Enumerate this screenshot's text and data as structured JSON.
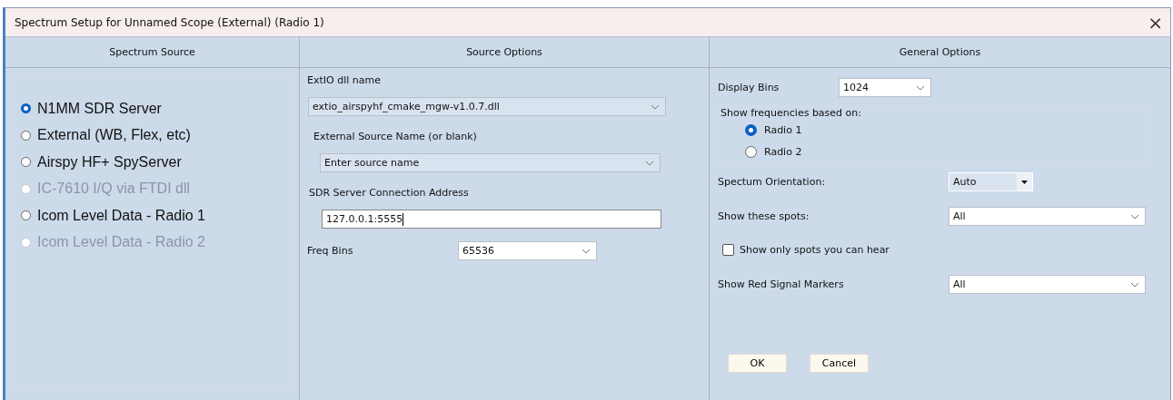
{
  "window": {
    "title": "Spectrum Setup for Unnamed Scope (External) (Radio 1)",
    "close": "×"
  },
  "columns": [
    {
      "title": "Spectrum Source"
    },
    {
      "title": "Source Options"
    },
    {
      "title": "General Options"
    }
  ],
  "spectrum_source": [
    {
      "label": "N1MM SDR Server",
      "selected": true,
      "disabled": false
    },
    {
      "label": "External (WB, Flex, etc)",
      "selected": false,
      "disabled": false
    },
    {
      "label": "Airspy HF+ SpyServer",
      "selected": false,
      "disabled": false
    },
    {
      "label": "IC-7610 I/Q via FTDI dll",
      "selected": false,
      "disabled": true
    },
    {
      "label": "Icom Level Data - Radio 1",
      "selected": false,
      "disabled": false
    },
    {
      "label": "Icom Level Data - Radio 2",
      "selected": false,
      "disabled": true
    }
  ],
  "source_options": [
    {
      "kind": "combo",
      "label": "ExtIO dll name",
      "value": "extio_airspyhf_cmake_mgw-v1.0.7.dll"
    },
    {
      "kind": "combo",
      "label": "External Source Name (or blank)",
      "value": "Enter source name"
    },
    {
      "kind": "text",
      "label": "SDR Server Connection Address",
      "value": "127.0.0.1:5555"
    },
    {
      "kind": "inline_combo",
      "label": "Freq Bins",
      "value": "65536"
    }
  ],
  "general_options": {
    "display_bins": {
      "label": "Display Bins",
      "value": "1024"
    },
    "frequency_group": {
      "label": "Show frequencies based on:",
      "options": [
        {
          "label": "Radio 1",
          "selected": true
        },
        {
          "label": "Radio 2",
          "selected": false
        }
      ]
    },
    "orientation": {
      "label": "Spectum Orientation:",
      "value": "Auto"
    },
    "spots": {
      "label": "Show these spots:",
      "value": "All"
    },
    "hear_only": {
      "label": "Show only spots you can hear",
      "checked": false
    },
    "red_markers": {
      "label": "Show Red Signal Markers",
      "value": "All"
    }
  },
  "buttons": [
    "OK",
    "Cancel"
  ]
}
